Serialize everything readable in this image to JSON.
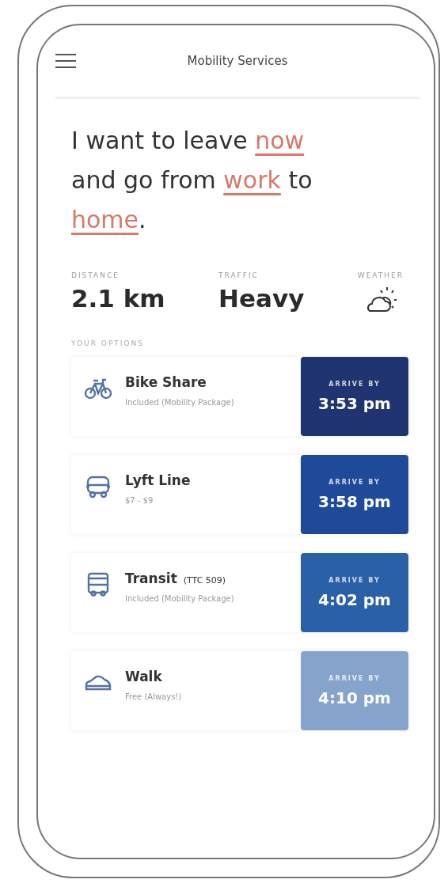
{
  "header": {
    "title": "Mobility Services"
  },
  "query": [
    {
      "text": "I want to leave ",
      "kind": "plain"
    },
    {
      "text": "now",
      "kind": "choice"
    },
    {
      "text": " and go from ",
      "kind": "plain"
    },
    {
      "text": "work",
      "kind": "choice"
    },
    {
      "text": " to ",
      "kind": "plain"
    },
    {
      "text": "home",
      "kind": "choice"
    },
    {
      "text": ".",
      "kind": "plain"
    }
  ],
  "stats": [
    {
      "label": "DISTANCE",
      "value": "2.1 km",
      "kind": "text"
    },
    {
      "label": "TRAFFIC",
      "value": "Heavy",
      "kind": "text"
    },
    {
      "label": "WEATHER",
      "kind": "weather"
    }
  ],
  "options_heading": "YOUR OPTIONS",
  "options": [
    {
      "kind": "bike",
      "name": "Bike Share",
      "detail": "Included (Mobility Package)",
      "arrive_label": "ARRIVE BY",
      "time": "3:53 pm",
      "color": "#1f3470"
    },
    {
      "kind": "car",
      "name": "Lyft Line",
      "detail": "$7 - $9",
      "arrive_label": "ARRIVE BY",
      "time": "3:58 pm",
      "color": "#1f4a9a"
    },
    {
      "kind": "bus",
      "name": "Transit",
      "note": "(TTC 509)",
      "detail": "Included (Mobility Package)",
      "arrive_label": "ARRIVE BY",
      "time": "4:02 pm",
      "color": "#2a60a8"
    },
    {
      "kind": "walk",
      "name": "Walk",
      "detail": "Free (Always!)",
      "arrive_label": "ARRIVE BY",
      "time": "4:10 pm",
      "color": "#86a3cc"
    }
  ]
}
